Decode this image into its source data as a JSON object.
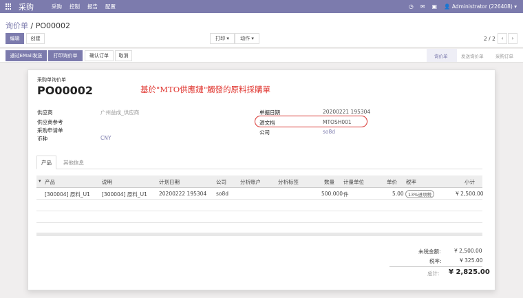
{
  "topbar": {
    "brand": "采购",
    "menu": [
      "采购",
      "控制",
      "报告",
      "配置"
    ],
    "user": "Administrator (226408)",
    "icons": [
      "apps-icon",
      "clock-icon",
      "chat-icon",
      "activity-icon",
      "user-icon"
    ]
  },
  "breadcrumb": {
    "parent": "询价单",
    "sep": "/",
    "current": "PO00002"
  },
  "buttons": {
    "edit": "编辑",
    "create": "创建",
    "print": "打印",
    "action": "动作"
  },
  "pager": {
    "text": "2 / 2"
  },
  "actions": {
    "send_email": "通过EMail发送",
    "print_rfq": "打印询价单",
    "confirm": "确认订单",
    "cancel": "取消"
  },
  "stages": [
    "询价单",
    "发送询价单",
    "采购订单"
  ],
  "form": {
    "doc_label": "采购单询价单",
    "doc_name": "PO00002",
    "annotation": "基於\"MTO供應鏈\"觸發的原料採購單",
    "left_fields": [
      {
        "label": "供应商",
        "value": "广州益成_供应商"
      },
      {
        "label": "供应商参考",
        "value": ""
      },
      {
        "label": "采购申请单",
        "value": ""
      },
      {
        "label": "币种",
        "value": "CNY"
      }
    ],
    "right_fields": [
      {
        "label": "单据日期",
        "value": "20200221 195304"
      },
      {
        "label": "源文档",
        "value": "MTOSH001"
      },
      {
        "label": "公司",
        "value": "so8d"
      }
    ]
  },
  "tabs": [
    "产品",
    "其他信息"
  ],
  "table": {
    "headers": [
      "产品",
      "说明",
      "计划日期",
      "公司",
      "分析账户",
      "分析标签",
      "数量",
      "计量单位",
      "单价",
      "税率",
      "小计"
    ],
    "rows": [
      {
        "product": "[300004] 原料_U1",
        "description": "[300004] 原料_U1",
        "date": "20200222 195304",
        "company": "so8d",
        "account": "",
        "tags": "",
        "qty": "500.000",
        "uom": "件",
        "price": "5.00",
        "tax": "13%进项税",
        "subtotal": "¥ 2,500.00"
      }
    ]
  },
  "totals": {
    "untaxed_label": "未税金额:",
    "untaxed": "¥ 2,500.00",
    "tax_label": "税率:",
    "tax": "¥ 325.00",
    "total_label": "总计:",
    "total": "¥ 2,825.00"
  },
  "colors": {
    "brand": "#7c7bad",
    "annotation": "#e0352f"
  }
}
